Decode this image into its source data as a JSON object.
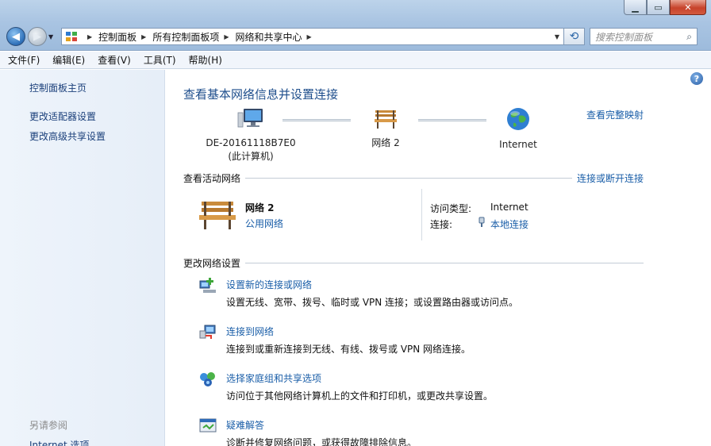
{
  "address": {
    "crumbs": [
      "控制面板",
      "所有控制面板项",
      "网络和共享中心"
    ],
    "search_placeholder": "搜索控制面板"
  },
  "menu": [
    "文件(F)",
    "编辑(E)",
    "查看(V)",
    "工具(T)",
    "帮助(H)"
  ],
  "sidebar": {
    "links": [
      "控制面板主页",
      "更改适配器设置",
      "更改高级共享设置"
    ],
    "see_also_header": "另请参阅",
    "see_also": [
      "Internet 选项"
    ]
  },
  "main": {
    "title": "查看基本网络信息并设置连接",
    "map_link": "查看完整映射",
    "nodes": {
      "computer_name": "DE-20161118B7E0",
      "computer_sub": "(此计算机)",
      "network": "网络  2",
      "internet": "Internet"
    },
    "active_section": "查看活动网络",
    "active_link": "连接或断开连接",
    "active": {
      "name": "网络  2",
      "type": "公用网络",
      "access_label": "访问类型:",
      "access_value": "Internet",
      "conn_label": "连接:",
      "conn_value": "本地连接"
    },
    "change_section": "更改网络设置",
    "tasks": [
      {
        "title": "设置新的连接或网络",
        "desc": "设置无线、宽带、拨号、临时或 VPN 连接；或设置路由器或访问点。",
        "icon": "new-connection-icon"
      },
      {
        "title": "连接到网络",
        "desc": "连接到或重新连接到无线、有线、拨号或 VPN 网络连接。",
        "icon": "connect-network-icon"
      },
      {
        "title": "选择家庭组和共享选项",
        "desc": "访问位于其他网络计算机上的文件和打印机，或更改共享设置。",
        "icon": "homegroup-icon"
      },
      {
        "title": "疑难解答",
        "desc": "诊断并修复网络问题，或获得故障排除信息。",
        "icon": "troubleshoot-icon"
      }
    ]
  }
}
